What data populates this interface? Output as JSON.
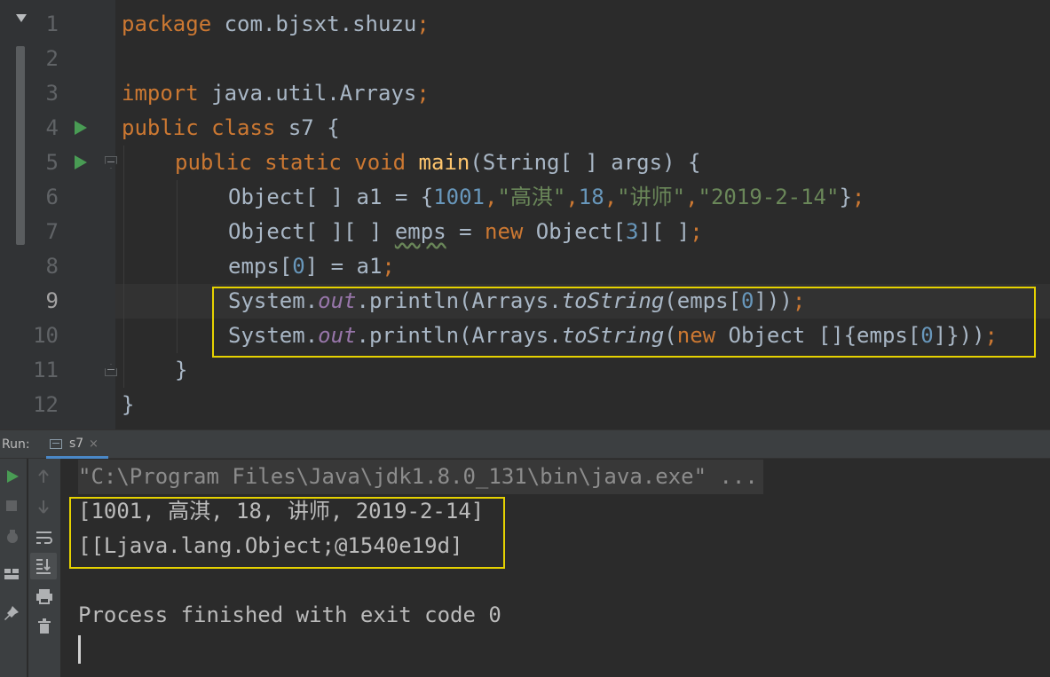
{
  "editor": {
    "line_numbers": [
      "1",
      "2",
      "3",
      "4",
      "5",
      "6",
      "7",
      "8",
      "9",
      "10",
      "11",
      "12"
    ],
    "lines": {
      "l1": {
        "kw": "package",
        "rest": " com.bjsxt.shuzu",
        "semi": ";"
      },
      "l3": {
        "kw": "import",
        "rest": " java.util.Arrays",
        "semi": ";"
      },
      "l4": {
        "kw": "public class",
        "rest": " s7 {"
      },
      "l5": {
        "kw": "public static void",
        "fn": "main",
        "rest": "(String[ ] args) {"
      },
      "l6": {
        "a": "Object[ ] a1 = {",
        "n1": "1001",
        "c1": ",",
        "s1": "\"高淇\"",
        "c2": ",",
        "n2": "18",
        "c3": ",",
        "s2": "\"讲师\"",
        "c4": ",",
        "s3": "\"2019-2-14\"",
        "b": "}",
        "semi": ";"
      },
      "l7": {
        "a": "Object[ ][ ] ",
        "v": "emps",
        "b": " = ",
        "kw": "new",
        "c": " Object[",
        "n": "3",
        "d": "][ ]",
        "semi": ";"
      },
      "l8": {
        "a": "emps[",
        "n": "0",
        "b": "] = a1",
        "semi": ";"
      },
      "l9": {
        "a": "System.",
        "out": "out",
        "b": ".println(Arrays.",
        "m": "toString",
        "c": "(emps[",
        "n": "0",
        "d": "]))",
        "semi": ";"
      },
      "l10": {
        "a": "System.",
        "out": "out",
        "b": ".println(Arrays.",
        "m": "toString",
        "c": "(",
        "kw": "new",
        "d": " Object []{emps[",
        "n": "0",
        "e": "]}))",
        "semi": ";"
      },
      "l11": {
        "a": "}"
      },
      "l12": {
        "a": "}"
      }
    }
  },
  "run_panel": {
    "label": "Run:",
    "tab_label": "s7",
    "tab_close": "×",
    "console_lines": [
      "\"C:\\Program Files\\Java\\jdk1.8.0_131\\bin\\java.exe\" ...",
      "[1001, 高淇, 18, 讲师, 2019-2-14]",
      "[[Ljava.lang.Object;@1540e19d]",
      "",
      "Process finished with exit code 0"
    ]
  },
  "icons": [
    "collapse-arrow-icon",
    "run-gutter-icon",
    "fold-icon",
    "console-tab-icon",
    "rerun-icon",
    "stop-icon",
    "debug-icon",
    "layout-icon",
    "pin-icon",
    "up-arrow-icon",
    "down-arrow-icon",
    "soft-wrap-icon",
    "scroll-to-end-icon",
    "print-icon",
    "trash-icon"
  ],
  "colors": {
    "keyword": "#cc7832",
    "string": "#6a8759",
    "number": "#6897bb",
    "function": "#ffc66d",
    "static_field": "#9876aa",
    "highlight_box": "#e6d200",
    "run_green": "#499c54"
  }
}
